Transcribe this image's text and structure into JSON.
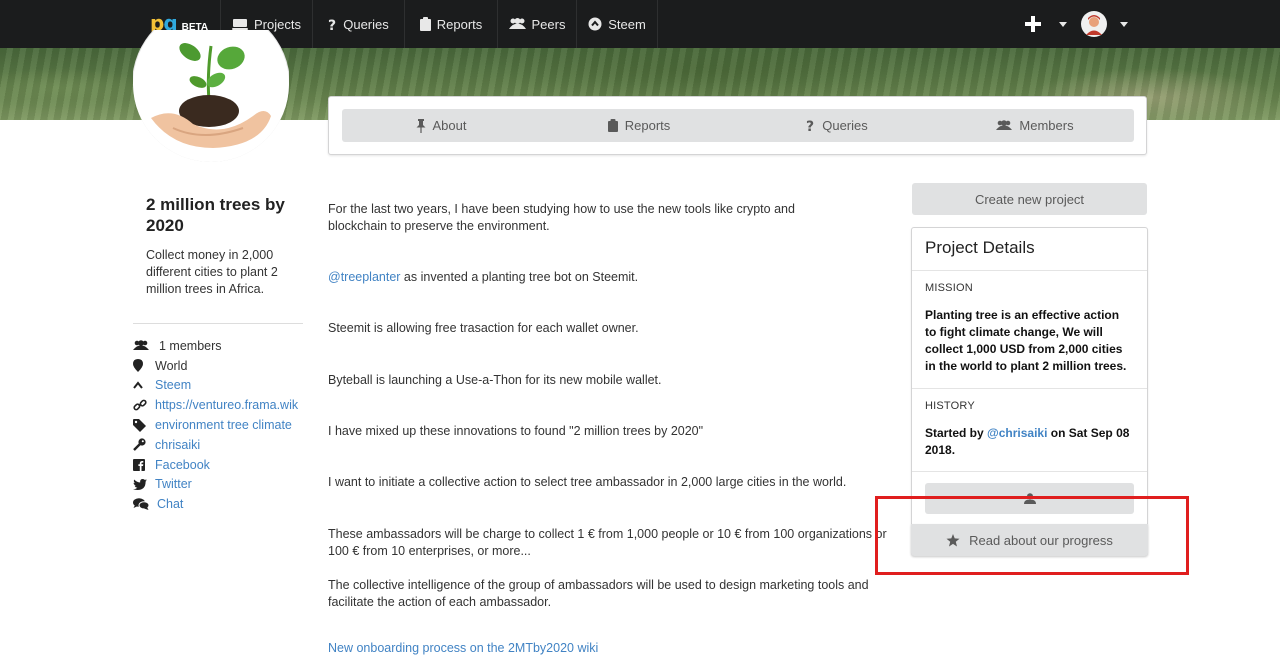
{
  "nav": {
    "logo_mark": "pq",
    "logo_beta": "BETA",
    "items": [
      {
        "label": "Projects",
        "icon": "projects-icon"
      },
      {
        "label": "Queries",
        "icon": "question-icon"
      },
      {
        "label": "Reports",
        "icon": "clipboard-icon"
      },
      {
        "label": "Peers",
        "icon": "users-icon"
      },
      {
        "label": "Steem",
        "icon": "steem-icon"
      }
    ]
  },
  "project": {
    "title": "2 million trees by 2020",
    "description": "Collect money in 2,000 different cities to plant 2 million trees in Africa.",
    "meta": [
      {
        "icon": "users-icon",
        "text": "1 members",
        "link": false
      },
      {
        "icon": "map-marker-icon",
        "text": "World",
        "link": false
      },
      {
        "icon": "steem-chevron-icon",
        "text": "Steem",
        "link": true
      },
      {
        "icon": "link-icon",
        "text": "https://ventureo.frama.wik",
        "link": true
      },
      {
        "icon": "tag-icon",
        "text": "environment tree climate",
        "link": true
      },
      {
        "icon": "key-icon",
        "text": "chrisaiki",
        "link": true
      },
      {
        "icon": "facebook-icon",
        "text": "Facebook",
        "link": true
      },
      {
        "icon": "twitter-icon",
        "text": "Twitter",
        "link": true
      },
      {
        "icon": "chat-icon",
        "text": "Chat",
        "link": true
      }
    ]
  },
  "tabs": [
    {
      "label": "About",
      "icon": "pin-icon"
    },
    {
      "label": "Reports",
      "icon": "clipboard-icon"
    },
    {
      "label": "Queries",
      "icon": "question-icon"
    },
    {
      "label": "Members",
      "icon": "users-icon"
    }
  ],
  "content": {
    "p1": "For the last two years, I have been studying how to use the new tools like crypto and blockchain to preserve the environment.",
    "p2_link": "@treeplanter",
    "p2_rest": " as invented a planting tree bot on Steemit.",
    "p3": "Steemit is allowing free trasaction for each wallet owner.",
    "p4": "Byteball is launching a Use-a-Thon for its new mobile wallet.",
    "p5": "I have mixed up these innovations to found \"2 million trees by 2020\"",
    "p6": "I want to initiate a collective action to select tree ambassador in 2,000 large cities in the world.",
    "p7": "These ambassadors will be charge to collect 1 € from 1,000 people or 10 € from 100 organizations or 100 € from 10 enterprises, or more...",
    "p8": "The collective intelligence of the group of ambassadors will be used to design marketing tools and facilitate the action of each ambassador.",
    "p9_link": "New onboarding process on the 2MTby2020 wiki"
  },
  "sidebar": {
    "create_label": "Create new project",
    "details_title": "Project Details",
    "mission_label": "MISSION",
    "mission_text": "Planting tree is an effective action to fight climate change, We will collect 1,000 USD from 2,000 cities in the world to plant 2 million trees.",
    "history_label": "HISTORY",
    "history_prefix": "Started by ",
    "history_user": "@chrisaiki",
    "history_suffix": " on Sat Sep 08 2018.",
    "progress_label": "Read about our progress"
  }
}
